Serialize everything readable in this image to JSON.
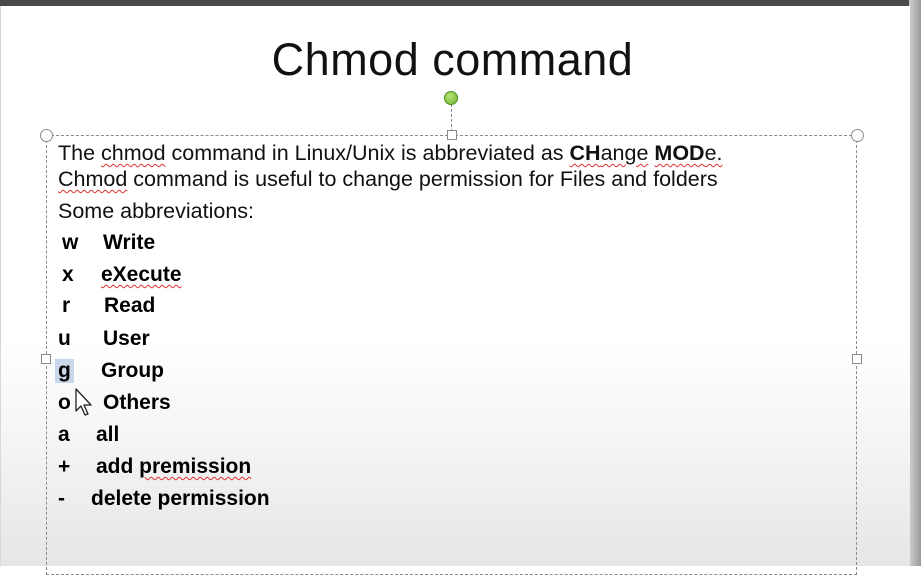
{
  "slide": {
    "title": "Chmod command",
    "intro": {
      "l1_a": "The ",
      "l1_chmod": "chmod",
      "l1_b": " command in Linux/Unix is abbreviated as ",
      "l1_ch": "CH",
      "l1_ange": "ange",
      "l1_space": " ",
      "l1_mod": "MOD",
      "l1_e": "e.",
      "l2_chmod": "Chmod",
      "l2_rest": " command is useful to change permission for Files and folders",
      "l3": "Some abbreviations:"
    },
    "abbreviations": [
      {
        "symbol": "w",
        "meaning": "Write"
      },
      {
        "symbol": "x",
        "meaning": "eXecute"
      },
      {
        "symbol": "r",
        "meaning": "Read"
      },
      {
        "symbol": "u",
        "meaning": "User"
      },
      {
        "symbol": "g",
        "meaning": "Group"
      },
      {
        "symbol": "o",
        "meaning": "Others"
      },
      {
        "symbol": "a",
        "meaning": "all"
      },
      {
        "symbol": "+",
        "meaning": "add premission"
      },
      {
        "symbol": "-",
        "meaning": "delete permission"
      }
    ]
  },
  "colors": {
    "rotation_handle": "#6cb52c",
    "selection_frame": "#7f8c99",
    "spellcheck": "#e03030",
    "text_selection": "#c8d7ea"
  },
  "icons": {
    "cursor": "mouse-pointer-icon"
  }
}
